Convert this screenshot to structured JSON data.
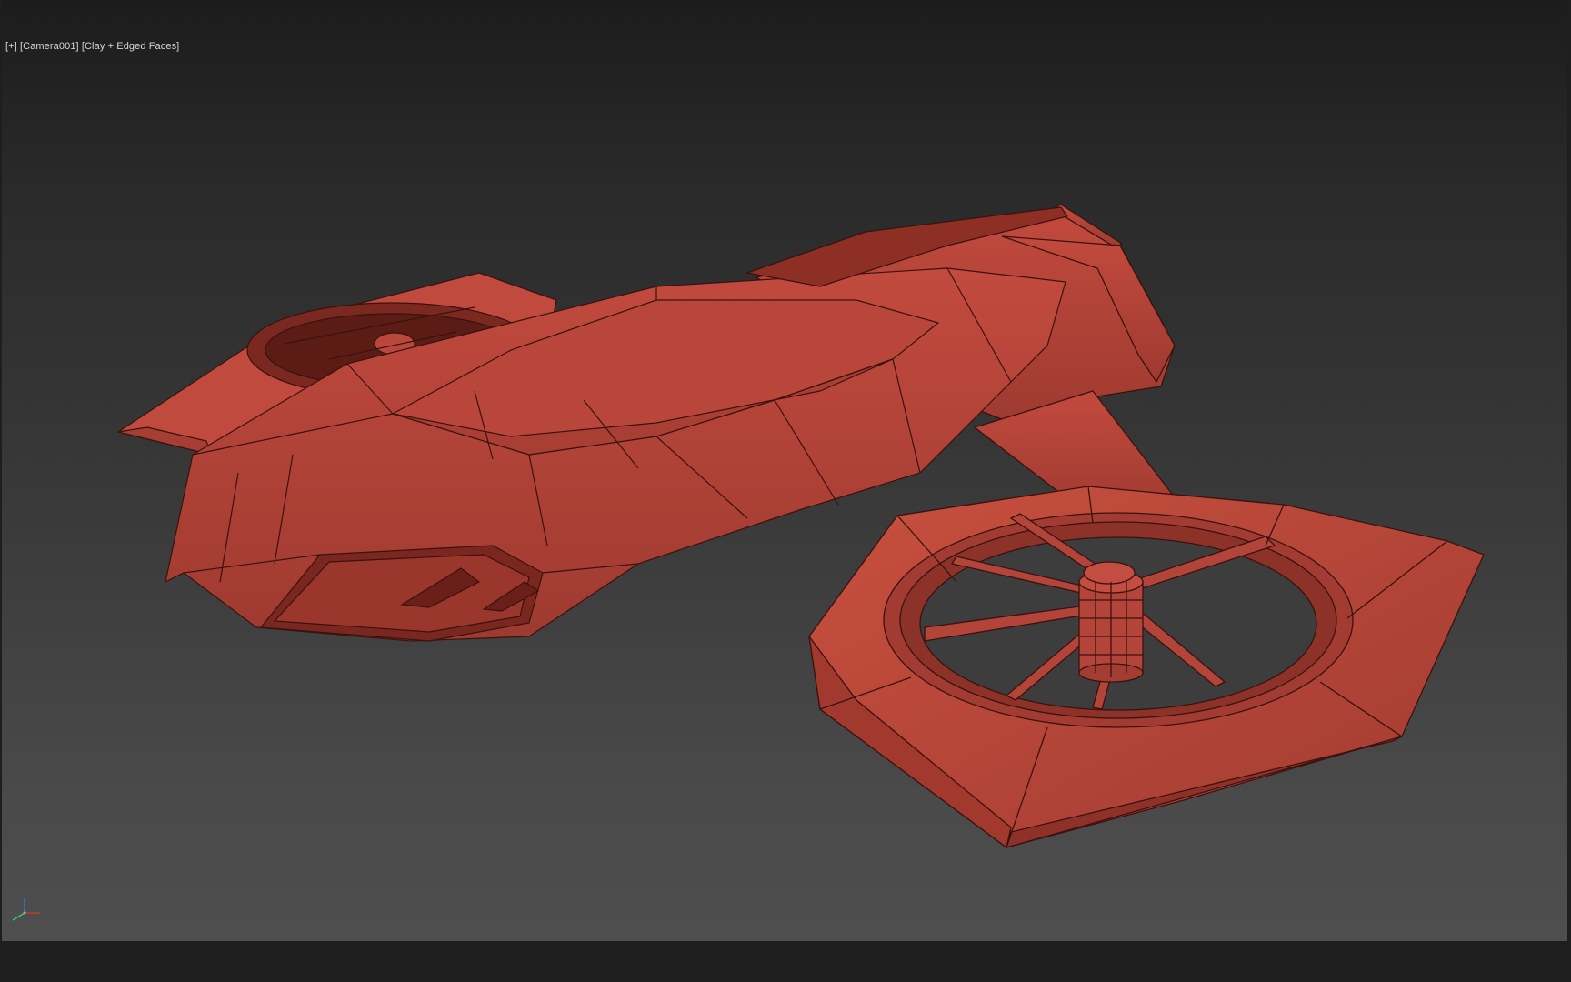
{
  "viewport": {
    "label": {
      "menu": "[+]",
      "camera": "[Camera001]",
      "shading": "[Clay + Edged Faces]"
    }
  },
  "model": {
    "name": "hover-craft-mesh",
    "color": "#b8453a",
    "edge_color": "#3a120e"
  },
  "gizmo": {
    "axes": [
      "x-axis",
      "y-axis",
      "z-axis"
    ],
    "colors": {
      "x": "#c0392b",
      "y": "#2ecc71",
      "z": "#3a6fd8"
    }
  }
}
